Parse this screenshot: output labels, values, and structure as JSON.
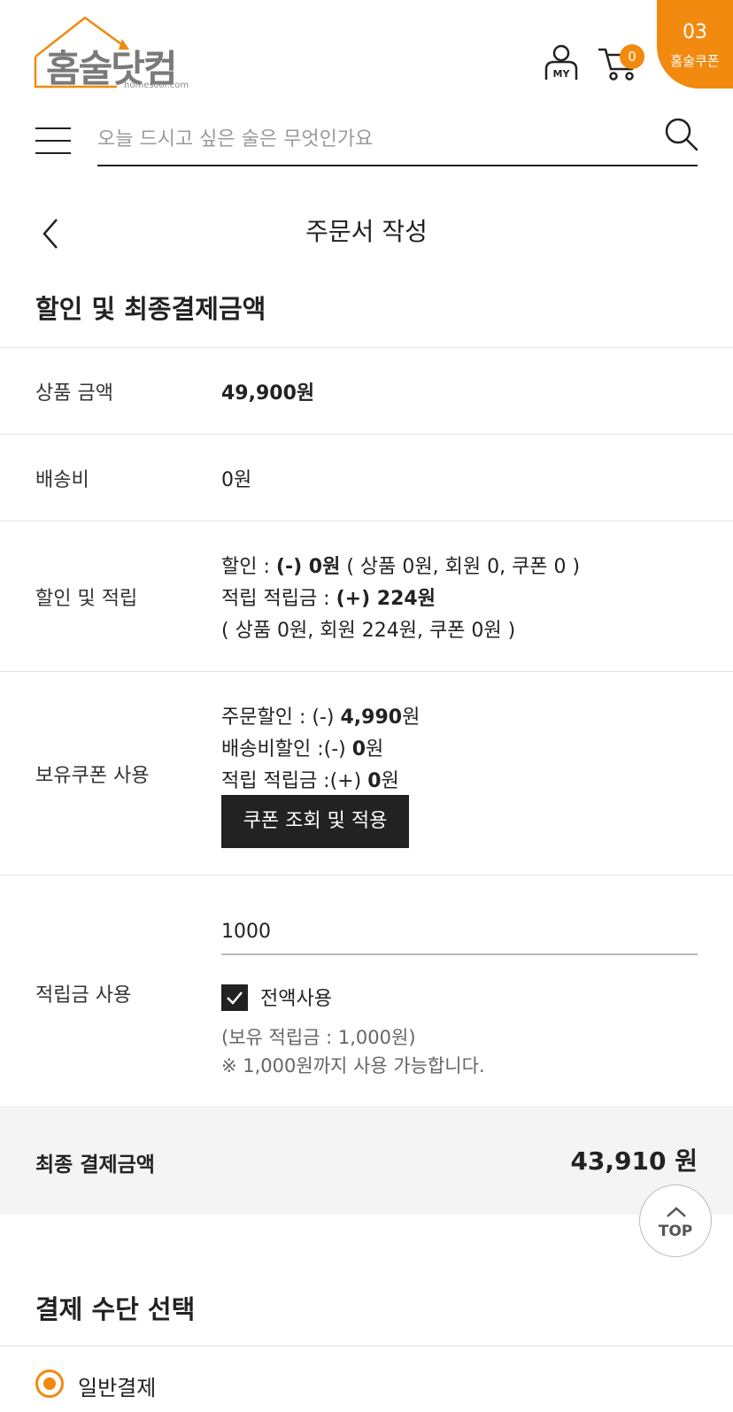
{
  "header": {
    "logo_text": "홈술닷컴",
    "logo_sub": "homesool.com",
    "my_label": "MY",
    "cart_count": "0",
    "coupon_count": "03",
    "coupon_label": "홈술쿠폰"
  },
  "search": {
    "placeholder": "오늘 드시고 싶은 술은 무엇인가요"
  },
  "page": {
    "title": "주문서 작성"
  },
  "discount_section": {
    "title": "할인 및 최종결제금액",
    "product_amount_label": "상품 금액",
    "product_amount_value": "49,900원",
    "shipping_label": "배송비",
    "shipping_value": "0원",
    "discount_label": "할인 및 적립",
    "discount_line1_prefix": "할인 : ",
    "discount_line1_bold": "(-) 0원",
    "discount_line1_suffix": " ( 상품 0원, 회원 0, 쿠폰 0 )",
    "discount_line2_prefix": "적립 적립금 : ",
    "discount_line2_bold": "(+) 224원",
    "discount_line3": "( 상품 0원, 회원 224원, 쿠폰 0원 )",
    "coupon_label": "보유쿠폰 사용",
    "coupon_line1_prefix": "주문할인 : (-) ",
    "coupon_line1_bold": "4,990",
    "coupon_line1_suffix": "원",
    "coupon_line2_prefix": "배송비할인 :(-) ",
    "coupon_line2_bold": "0",
    "coupon_line2_suffix": "원",
    "coupon_line3_prefix": "적립 적립금 :(+) ",
    "coupon_line3_bold": "0",
    "coupon_line3_suffix": "원",
    "coupon_button": "쿠폰 조회 및 적용",
    "points_label": "적립금 사용",
    "points_value": "1000",
    "use_all_label": "전액사용",
    "points_owned": "(보유 적립금 : 1,000원)",
    "points_note": "※ 1,000원까지 사용 가능합니다.",
    "final_label": "최종 결제금액",
    "final_amount": "43,910 원"
  },
  "top_button": "TOP",
  "payment_section": {
    "title": "결제 수단 선택",
    "option_general": "일반결제"
  },
  "colors": {
    "accent": "#f18a0e",
    "dark": "#222222"
  }
}
